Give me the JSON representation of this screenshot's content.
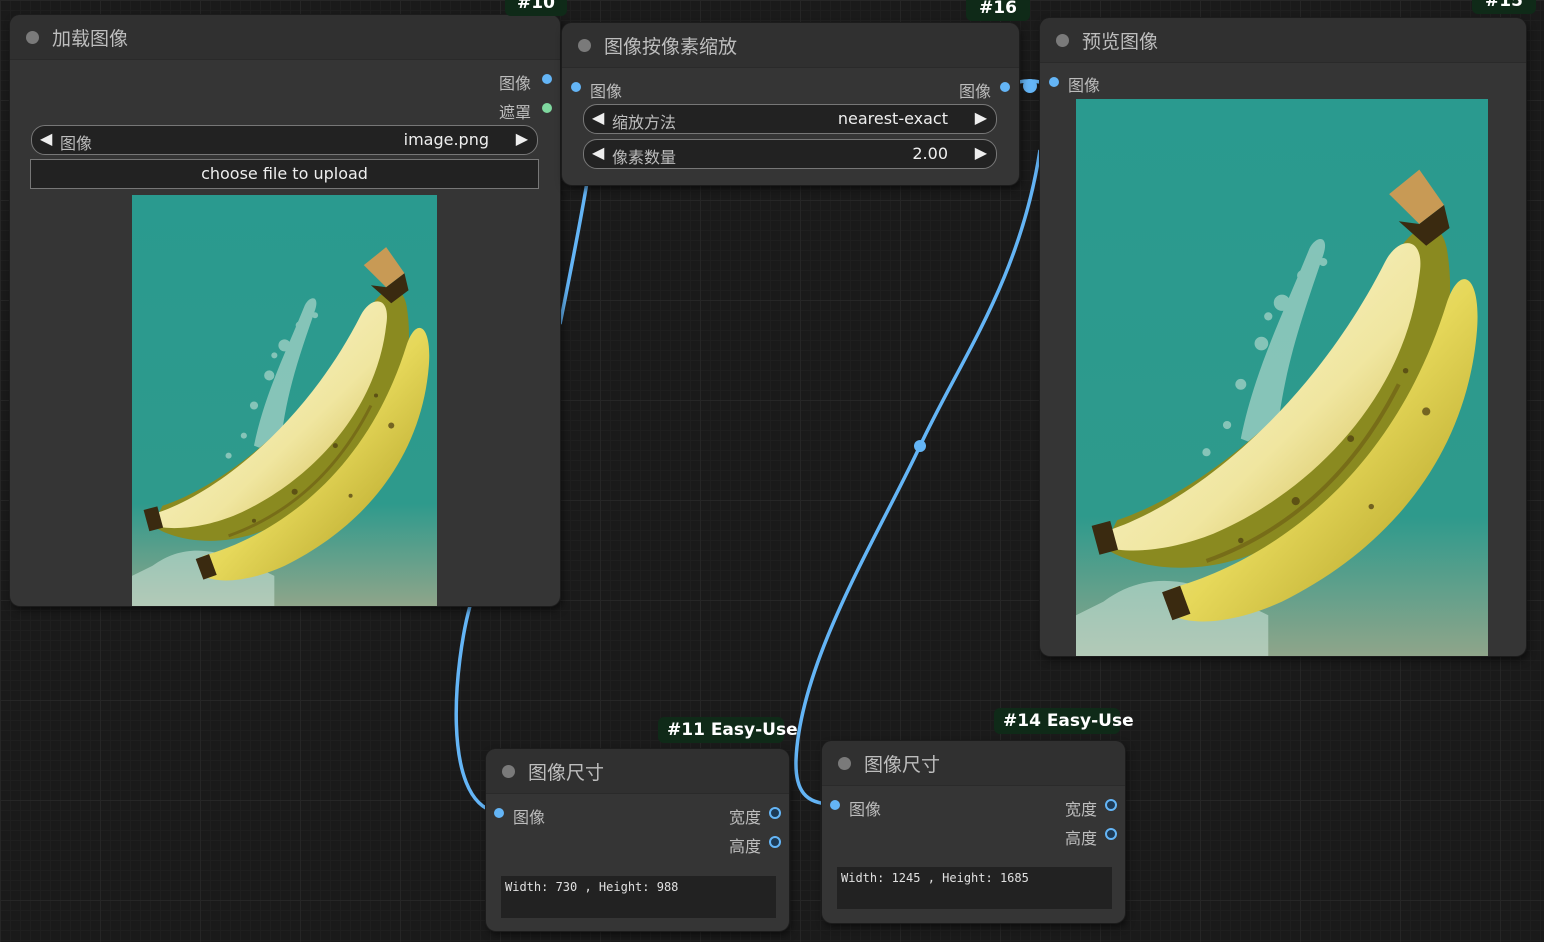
{
  "colors": {
    "canvas": "#1a1a1a",
    "node_bg": "#353535",
    "wire_image": "#64b5f6",
    "slot_mask": "#7fd89f",
    "badge_bg": "#0f2a18"
  },
  "nodes": {
    "load_image": {
      "badge": "#10",
      "title": "加载图像",
      "outputs": [
        "图像",
        "遮罩"
      ],
      "image_widget": {
        "label": "图像",
        "value": "image.png"
      },
      "upload_label": "choose file to upload",
      "preview_icon": "banana-image"
    },
    "upscale": {
      "badge": "#16",
      "title": "图像按像素缩放",
      "input": "图像",
      "output": "图像",
      "method_widget": {
        "label": "缩放方法",
        "value": "nearest-exact"
      },
      "megapixels_widget": {
        "label": "像素数量",
        "value": "2.00"
      }
    },
    "preview": {
      "badge": "#15",
      "title": "预览图像",
      "input": "图像",
      "preview_icon": "banana-image"
    },
    "size_11": {
      "badge": "#11 Easy-Use",
      "title": "图像尺寸",
      "input": "图像",
      "outputs": [
        "宽度",
        "高度"
      ],
      "text": "Width: 730 , Height: 988"
    },
    "size_14": {
      "badge": "#14 Easy-Use",
      "title": "图像尺寸",
      "input": "图像",
      "outputs": [
        "宽度",
        "高度"
      ],
      "text": "Width: 1245 , Height: 1685"
    }
  }
}
